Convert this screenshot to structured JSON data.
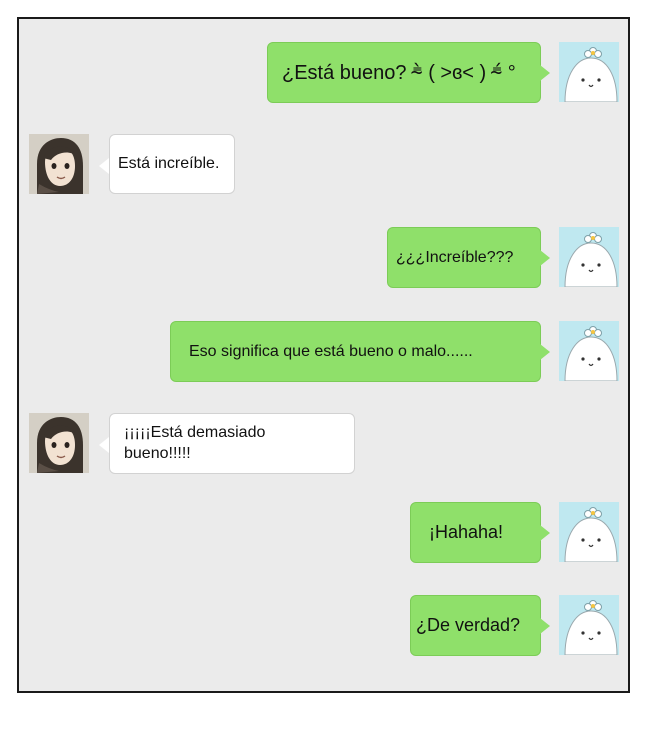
{
  "chat": {
    "messages": [
      {
        "sender": "me",
        "text": "¿Está bueno? ⁼̴̀ ( ˃ɞ˂ ) ⁼̴́ °"
      },
      {
        "sender": "friend",
        "text": "Está increíble."
      },
      {
        "sender": "me",
        "text": "¿¿¿Increíble???"
      },
      {
        "sender": "me",
        "text": "Eso significa que está bueno o malo......"
      },
      {
        "sender": "friend",
        "text": "¡¡¡¡¡Está demasiado bueno!!!!!"
      },
      {
        "sender": "me",
        "text": "¡Hahaha!"
      },
      {
        "sender": "me",
        "text": "¿De verdad?"
      }
    ]
  },
  "colors": {
    "chat_background": "#ebebeb",
    "outgoing_bubble": "#8fe06a",
    "incoming_bubble": "#ffffff",
    "my_avatar_background": "#bfe8f0"
  },
  "avatars": {
    "me": "white-blob-with-flower-icon",
    "friend": "dark-haired-character-icon"
  }
}
